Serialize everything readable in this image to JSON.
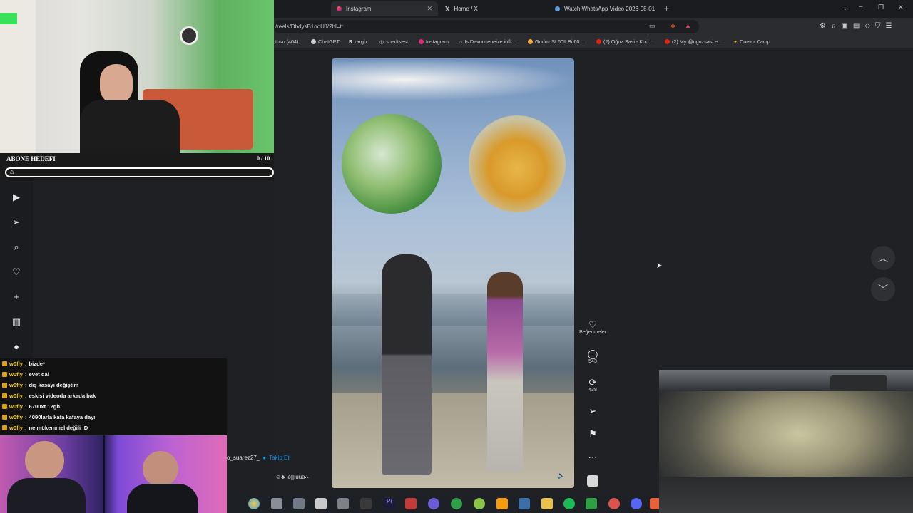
{
  "browser": {
    "tabs": [
      {
        "title": "Instagram",
        "active": true
      },
      {
        "title": "Home / X",
        "active": false
      },
      {
        "title": "Watch WhatsApp Video 2026-08-01",
        "active": false
      }
    ],
    "url": "/reels/DbdysB1ooUJ/?hl=tr",
    "bookmarks": [
      "tusu (404)...",
      "ChatGPT",
      "rargb",
      "spedtsest",
      "Instagram",
      "Is Davooxeneize infl...",
      "Godox SL60II Bi 60...",
      "(2) Oğuz Sasi - Kod...",
      "(2) My @oguzsasi e...",
      "Cursor Camp"
    ]
  },
  "reel": {
    "actions": {
      "like_label": "Beğenmeler",
      "comment_count": "543",
      "repost_count": "438"
    },
    "author": "o_suarez27_",
    "follow_label": "Takip Et",
    "caption_tail": "ǝןןıuuǝ∴"
  },
  "overlay": {
    "goal_label": "ABONE HEDEFI",
    "goal_count": "0 / 10",
    "goal_progress": 0,
    "chat": [
      {
        "user": "w0fly",
        "text": "bizde*"
      },
      {
        "user": "w0fly",
        "text": "evet dai"
      },
      {
        "user": "w0fly",
        "text": "dış kasayı değiştim"
      },
      {
        "user": "w0fly",
        "text": "eskisi videoda arkada bak"
      },
      {
        "user": "w0fly",
        "text": "6700xt 12gb"
      },
      {
        "user": "w0fly",
        "text": "4090larla kafa kafaya dayı"
      },
      {
        "user": "w0fly",
        "text": "ne mükemmel değili :D"
      }
    ]
  },
  "icons": {
    "sidebar": [
      "reels-icon",
      "send-icon",
      "search-icon",
      "heart-icon",
      "plus-icon",
      "stats-icon",
      "avatar-icon"
    ],
    "nav": [
      "chevron-up-icon",
      "chevron-down-icon"
    ]
  },
  "colors": {
    "accent": "#0095f6",
    "chat_user": "#f1cc36",
    "browser_bg": "#202124"
  }
}
